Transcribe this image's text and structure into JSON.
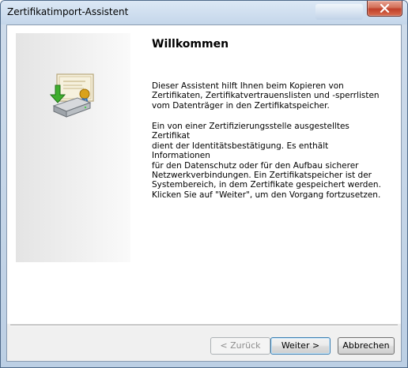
{
  "window": {
    "title": "Zertifikatimport-Assistent",
    "background_tab_text": "Zertifikat"
  },
  "icons": {
    "wizard_icon": "certificate-import-icon",
    "close": "close-icon"
  },
  "content": {
    "heading": "Willkommen",
    "paragraph1": "Dieser Assistent hilft Ihnen beim Kopieren von\nZertifikaten, Zertifikatvertrauenslisten und -sperrlisten\nvom Datenträger in den Zertifikatspeicher.",
    "paragraph2": "Ein von einer Zertifizierungsstelle ausgestelltes Zertifikat\ndient der Identitätsbestätigung. Es enthält Informationen\nfür den Datenschutz oder für den Aufbau sicherer\nNetzwerkverbindungen. Ein Zertifikatspeicher ist der\nSystembereich, in dem Zertifikate gespeichert werden.",
    "paragraph3": "Klicken Sie auf \"Weiter\", um den Vorgang fortzusetzen."
  },
  "buttons": {
    "back": "< Zurück",
    "next": "Weiter >",
    "cancel": "Abbrechen"
  },
  "colors": {
    "close_button": "#c0402a",
    "default_button_border": "#3c7fb1"
  }
}
